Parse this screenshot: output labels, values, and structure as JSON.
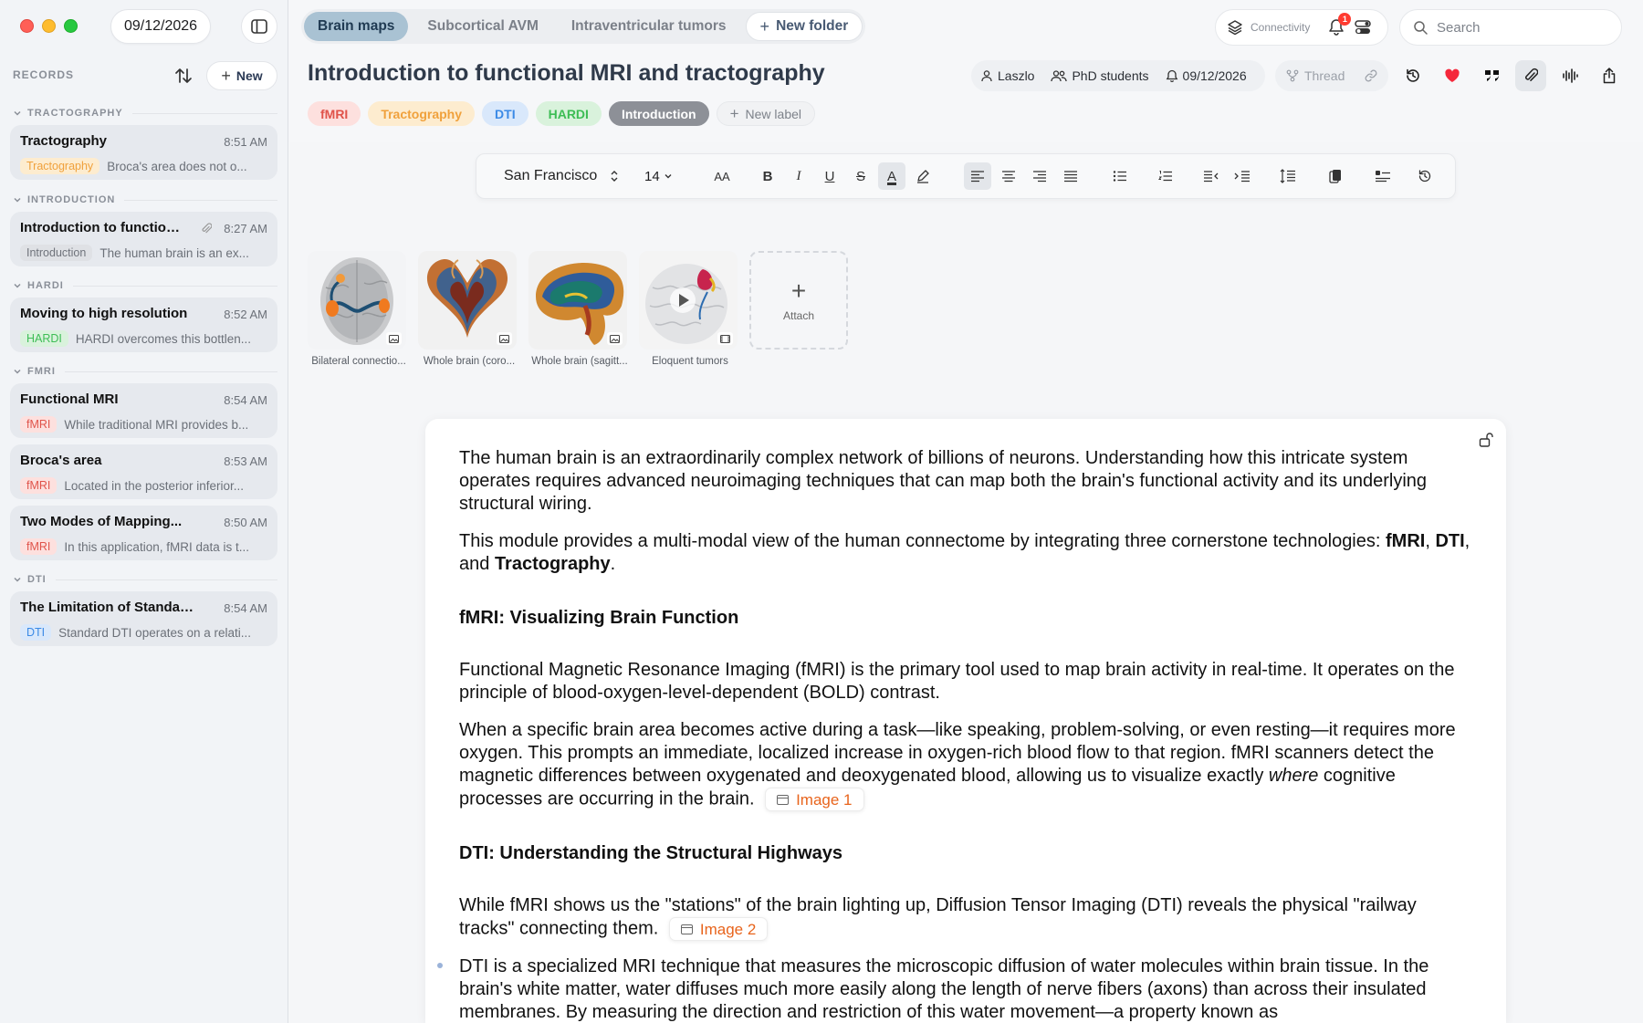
{
  "window": {
    "date": "09/12/2026"
  },
  "sidebar": {
    "records_title": "RECORDS",
    "new_label": "New",
    "groups": [
      {
        "label": "TRACTOGRAPHY",
        "records": [
          {
            "title": "Tractography",
            "time": "8:51 AM",
            "tag": "Tractography",
            "preview": "Broca's area does not o..."
          }
        ]
      },
      {
        "label": "INTRODUCTION",
        "records": [
          {
            "title": "Introduction to function...",
            "time": "8:27 AM",
            "tag": "Introduction",
            "preview": "The human brain is an ex..."
          }
        ]
      },
      {
        "label": "HARDI",
        "records": [
          {
            "title": "Moving to high resolution",
            "time": "8:52 AM",
            "tag": "HARDI",
            "preview": "HARDI overcomes this bottlen..."
          }
        ]
      },
      {
        "label": "FMRI",
        "records": [
          {
            "title": "Functional MRI",
            "time": "8:54 AM",
            "tag": "fMRI",
            "preview": "While traditional MRI provides b..."
          },
          {
            "title": "Broca's area",
            "time": "8:53 AM",
            "tag": "fMRI",
            "preview": "Located in the posterior inferior..."
          },
          {
            "title": "Two Modes of Mapping...",
            "time": "8:50 AM",
            "tag": "fMRI",
            "preview": "In this application, fMRI data is t..."
          }
        ]
      },
      {
        "label": "DTI",
        "records": [
          {
            "title": "The Limitation of Standard...",
            "time": "8:54 AM",
            "tag": "DTI",
            "preview": "Standard DTI operates on a relati..."
          }
        ]
      }
    ]
  },
  "tabs": [
    {
      "label": "Brain maps"
    },
    {
      "label": "Subcortical AVM"
    },
    {
      "label": "Intraventricular tumors"
    },
    {
      "label": "New folder"
    }
  ],
  "topbar": {
    "connectivity_label": "Connectivity",
    "notification_count": "1",
    "search_placeholder": "Search"
  },
  "document": {
    "title": "Introduction to functional MRI and tractography",
    "meta": {
      "author": "Laszlo",
      "group": "PhD students",
      "date": "09/12/2026",
      "thread": "Thread"
    },
    "labels": [
      {
        "label": "fMRI"
      },
      {
        "label": "Tractography"
      },
      {
        "label": "DTI"
      },
      {
        "label": "HARDI"
      },
      {
        "label": "Introduction"
      },
      {
        "label": "New label"
      }
    ],
    "toolbar": {
      "font": "San Francisco",
      "size": "14",
      "case": "AA",
      "bold": "B",
      "italic": "I",
      "underline": "U",
      "strike": "S",
      "color": "A"
    },
    "attachments": [
      {
        "name": "Bilateral connectio...",
        "kind": "image"
      },
      {
        "name": "Whole brain (coro...",
        "kind": "image"
      },
      {
        "name": "Whole brain (sagitt...",
        "kind": "image"
      },
      {
        "name": "Eloquent tumors",
        "kind": "video"
      }
    ],
    "attach_label": "Attach",
    "body": {
      "p1": "The human brain is an extraordinarily complex network of billions of neurons. Understanding how this intricate system operates requires advanced neuroimaging techniques that can map both the brain's functional activity and its underlying structural wiring.",
      "p2_start": "This module provides a multi-modal view of the human connectome by integrating three cornerstone technologies: ",
      "p2_b1": "fMRI",
      "p2_sep1": ", ",
      "p2_b2": "DTI",
      "p2_sep2": ", and ",
      "p2_b3": "Tractography",
      "p2_end": ".",
      "h1": "fMRI: Visualizing Brain Function",
      "p3": "Functional Magnetic Resonance Imaging (fMRI) is the primary tool used to map brain activity in real-time. It operates on the principle of blood-oxygen-level-dependent (BOLD) contrast.",
      "p4_start": "When a specific brain area becomes active during a task—like speaking, problem-solving, or even resting—it requires more oxygen. This prompts an immediate, localized increase in oxygen-rich blood flow to that region. fMRI scanners detect the magnetic differences between oxygenated and deoxygenated blood, allowing us to visualize exactly ",
      "p4_em": "where",
      "p4_end": " cognitive processes are occurring in the brain.",
      "image1": "Image 1",
      "h2": "DTI: Understanding the Structural Highways",
      "p5": "While fMRI shows us the \"stations\" of the brain lighting up, Diffusion Tensor Imaging (DTI) reveals the physical \"railway tracks\" connecting them.",
      "image2": "Image 2",
      "p6": "DTI is a specialized MRI technique that measures the microscopic diffusion of water molecules within brain tissue. In the brain's white matter, water diffuses much more easily along the length of nerve fibers (axons) than across their insulated membranes. By measuring the direction and restriction of this water movement—a property known as"
    }
  }
}
